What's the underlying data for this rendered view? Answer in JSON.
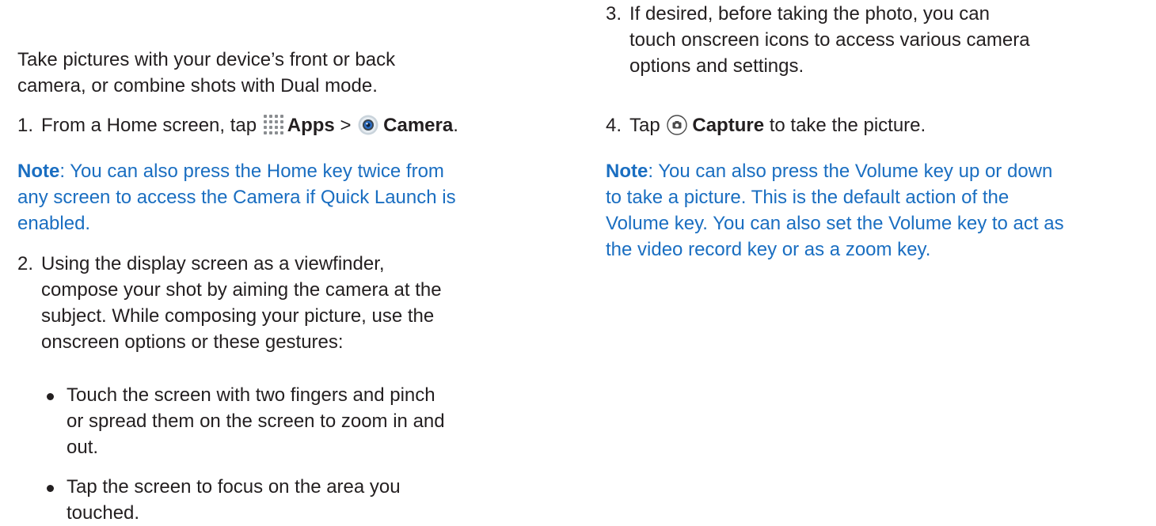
{
  "left": {
    "intro": {
      "line1": "Take pictures with your device’s front or back",
      "line2": "camera, or combine shots with Dual mode."
    },
    "step1": {
      "num": "1.",
      "pre": "From a Home screen, tap",
      "apps": "Apps",
      "sep": ">",
      "camera": "Camera",
      "end": "."
    },
    "note1": {
      "label": "Note",
      "line1": ": You can also press the Home key twice from",
      "line2": "any screen to access the Camera if Quick Launch is",
      "line3": "enabled."
    },
    "step2": {
      "num": "2.",
      "line1": "Using the display screen as a viewfinder,",
      "line2": "compose your shot by aiming the camera at the",
      "line3": "subject. While composing your picture, use the",
      "line4": "onscreen options or these gestures:"
    },
    "bullet1": {
      "line1": "Touch the screen with two fingers and pinch",
      "line2": "or spread them on the screen to zoom in and",
      "line3": "out."
    },
    "bullet2": {
      "line1": "Tap the screen to focus on the area you",
      "line2": "touched."
    }
  },
  "right": {
    "step3": {
      "num": "3.",
      "line1": "If desired, before taking the photo, you can",
      "line2": "touch onscreen icons to access various camera",
      "line3": "options and settings."
    },
    "step4": {
      "num": "4.",
      "pre": "Tap",
      "capture": "Capture",
      "post": "to take the picture."
    },
    "note2": {
      "label": "Note",
      "line1": ": You can also press the Volume key up or down",
      "line2": "to take a picture. This is the default action of the",
      "line3": "Volume key. You can also set the Volume key to act as",
      "line4": "the video record key or as a zoom key."
    }
  },
  "icons": {
    "apps": "apps-grid-icon",
    "camera": "camera-app-icon",
    "capture": "capture-button-icon"
  },
  "colors": {
    "text": "#231f20",
    "note": "#1a6ec1"
  }
}
